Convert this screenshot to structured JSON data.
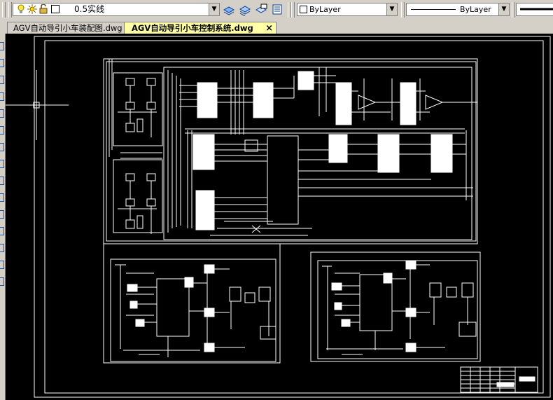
{
  "toolbar": {
    "layer_name": "0.5实线",
    "color_value": "ByLayer",
    "linetype_value": "ByLayer",
    "lineweight_value": ""
  },
  "tabs": [
    {
      "label": "AGV自动导引小车装配图.dwg",
      "active": false
    },
    {
      "label": "AGV自动导引小车控制系统.dwg",
      "active": true
    }
  ],
  "tab_close_glyph": "×",
  "canvas": {
    "background": "#000000",
    "line_color": "#ffffff"
  }
}
